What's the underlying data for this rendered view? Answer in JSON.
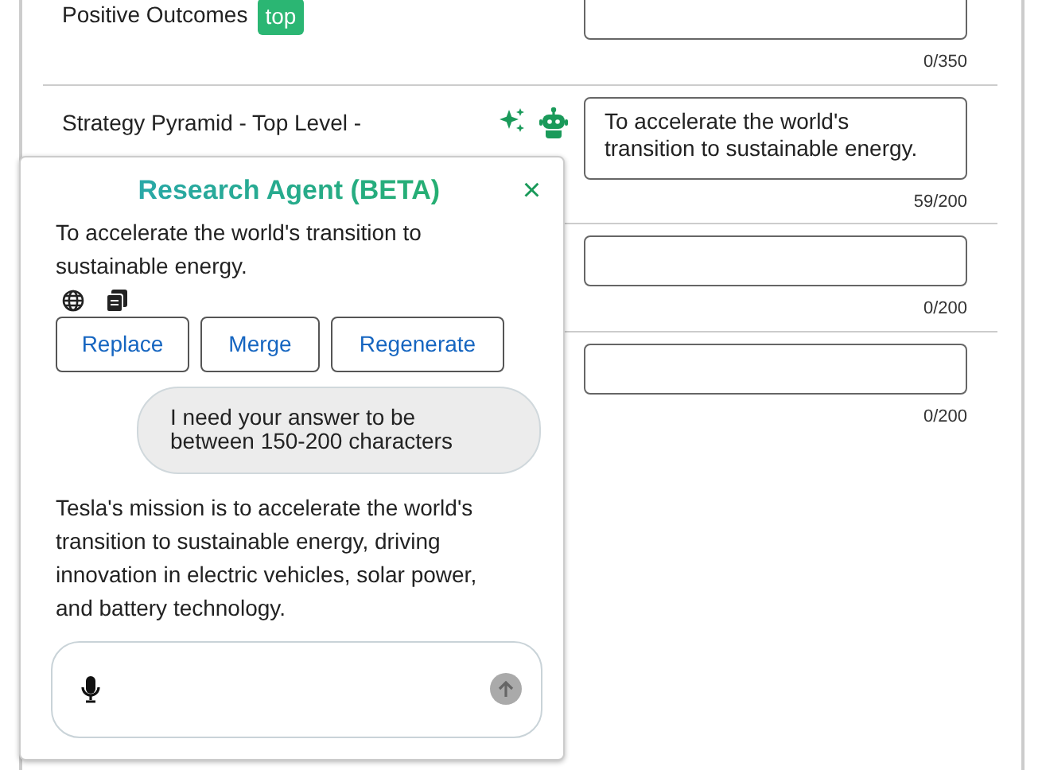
{
  "rows": [
    {
      "kind": "plain",
      "label": "Positive Outcomes",
      "badge": "top",
      "value": "",
      "counter": "0/350"
    },
    {
      "kind": "assisted",
      "label": "Strategy Pyramid - Top Level -",
      "value": "To accelerate the world's transition to sustainable energy.",
      "counter": "59/200"
    },
    {
      "kind": "plain",
      "value": "",
      "counter": "0/200"
    },
    {
      "kind": "plain",
      "value": "",
      "counter": "0/200"
    }
  ],
  "agent": {
    "title": "Research Agent (BETA)",
    "close": "×",
    "suggestion": "To accelerate the world's transition to sustainable energy.",
    "actions": [
      "Replace",
      "Merge",
      "Regenerate"
    ],
    "messages": [
      {
        "kind": "bubble",
        "text": "I need your answer to be between 150-200 characters"
      },
      {
        "kind": "reply",
        "text": "Tesla's mission is to accelerate the world's transition to sustainable energy, driving innovation in electric vehicles, solar power, and battery technology."
      }
    ]
  }
}
